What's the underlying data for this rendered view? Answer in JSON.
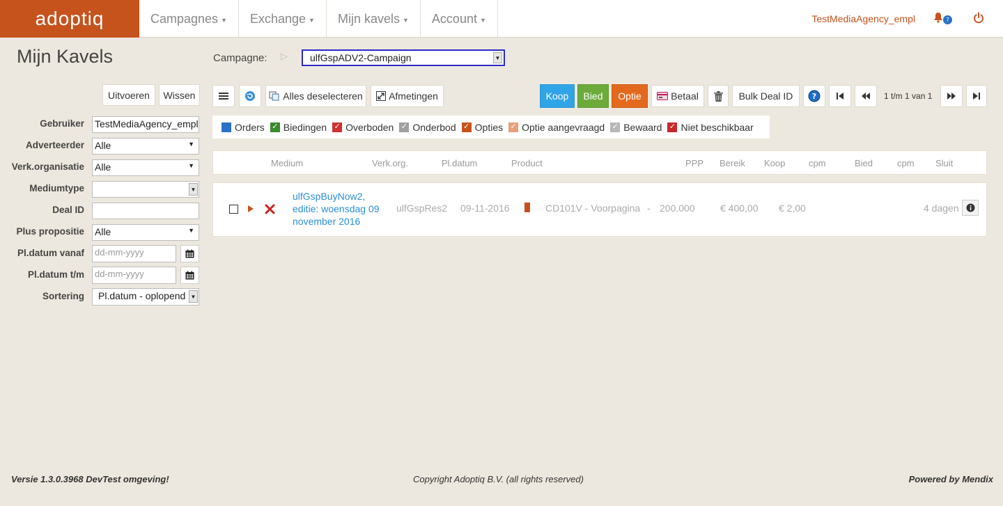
{
  "app": {
    "logo": "adoptiq",
    "user": "TestMediaAgency_empl",
    "notifications": "7"
  },
  "nav": [
    {
      "label": "Campagnes"
    },
    {
      "label": "Exchange"
    },
    {
      "label": "Mijn kavels"
    },
    {
      "label": "Account"
    }
  ],
  "page": {
    "title": "Mijn Kavels",
    "campaign_label": "Campagne:",
    "campaign_value": "ulfGspADV2-Campaign"
  },
  "filters": {
    "run_label": "Uitvoeren",
    "clear_label": "Wissen",
    "fields": [
      {
        "label": "Gebruiker",
        "value": "TestMediaAgency_empl"
      },
      {
        "label": "Adverteerder",
        "value": "Alle"
      },
      {
        "label": "Verk.organisatie",
        "value": "Alle"
      },
      {
        "label": "Mediumtype",
        "value": ""
      },
      {
        "label": "Deal ID",
        "value": ""
      },
      {
        "label": "Plus propositie",
        "value": "Alle"
      },
      {
        "label": "Pl.datum vanaf",
        "placeholder": "dd-mm-yyyy"
      },
      {
        "label": "Pl.datum t/m",
        "placeholder": "dd-mm-yyyy"
      },
      {
        "label": "Sortering",
        "value": "Pl.datum - oplopend"
      }
    ]
  },
  "toolbar": {
    "deselect_all": "Alles deselecteren",
    "measurements": "Afmetingen",
    "koop": "Koop",
    "bied": "Bied",
    "optie": "Optie",
    "betaal": "Betaal",
    "bulk_deal": "Bulk Deal ID",
    "page_info": "1 t/m 1 van 1"
  },
  "legend": [
    {
      "label": "Orders",
      "color": "#2a72c7",
      "checked": false
    },
    {
      "label": "Biedingen",
      "color": "#3c8a2e",
      "checked": true
    },
    {
      "label": "Overboden",
      "color": "#d32f2f",
      "checked": true
    },
    {
      "label": "Onderbod",
      "color": "#a0a0a0",
      "checked": true
    },
    {
      "label": "Opties",
      "color": "#c6531c",
      "checked": true
    },
    {
      "label": "Optie aangevraagd",
      "color": "#e8a07a",
      "checked": true
    },
    {
      "label": "Bewaard",
      "color": "#b8b8b8",
      "checked": true
    },
    {
      "label": "Niet beschikbaar",
      "color": "#c62828",
      "checked": true
    }
  ],
  "table": {
    "headers": [
      "Medium",
      "Verk.org.",
      "Pl.datum",
      "Product",
      "PPP",
      "Bereik",
      "Koop",
      "cpm",
      "Bied",
      "cpm",
      "Sluit"
    ],
    "rows": [
      {
        "medium": "ulfGspBuyNow2, editie: woensdag 09 november 2016",
        "verk_org": "ulfGspRes2",
        "pl_datum": "09-11-2016",
        "status_color": "#c6531c",
        "product": "CD101V - Voorpagina",
        "ppp": "-",
        "bereik": "200.000",
        "koop": "€ 400,00",
        "koop_cpm": "€ 2,00",
        "sluit": "4 dagen"
      }
    ]
  },
  "footer": {
    "version": "Versie 1.3.0.3968 DevTest omgeving!",
    "copyright": "Copyright Adoptiq B.V. (all rights reserved)",
    "powered": "Powered by Mendix"
  }
}
